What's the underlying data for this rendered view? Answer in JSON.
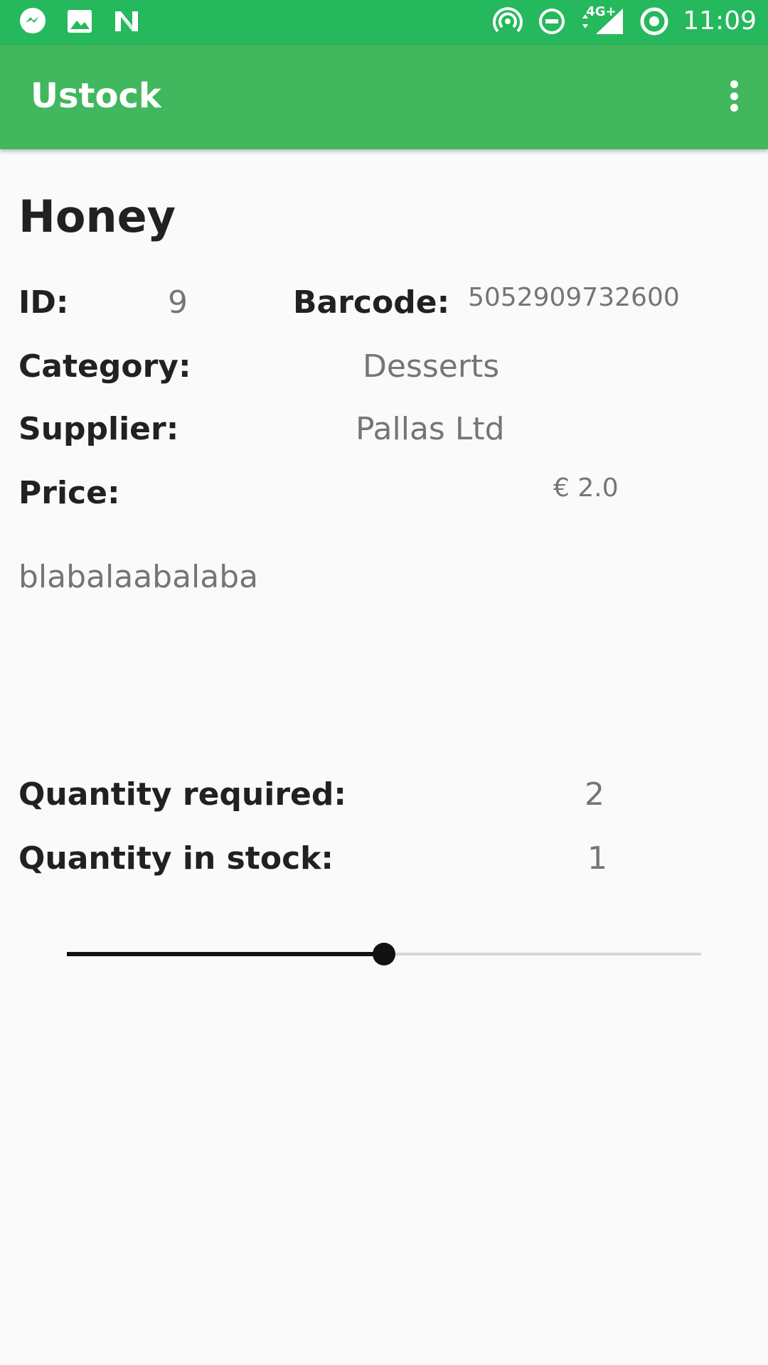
{
  "status_bar": {
    "time": "11:09",
    "network": "4G+",
    "left_icons": [
      "messenger-icon",
      "gallery-icon",
      "n-app-icon"
    ],
    "right_icons": [
      "hotspot-icon",
      "do-not-disturb-icon",
      "signal-icon",
      "sync-icon"
    ]
  },
  "app_bar": {
    "title": "Ustock",
    "menu_icon": "more-vert-icon"
  },
  "product": {
    "name": "Honey",
    "id_label": "ID:",
    "id_value": "9",
    "barcode_label": "Barcode:",
    "barcode_value": "5052909732600",
    "category_label": "Category:",
    "category_value": "Desserts",
    "supplier_label": "Supplier:",
    "supplier_value": "Pallas Ltd",
    "price_label": "Price:",
    "price_value": "€ 2.0",
    "description": "blabalaabalaba",
    "qty_required_label": "Quantity required:",
    "qty_required_value": "2",
    "qty_stock_label": "Quantity in stock:",
    "qty_stock_value": "1"
  },
  "slider": {
    "fraction": 0.5
  }
}
